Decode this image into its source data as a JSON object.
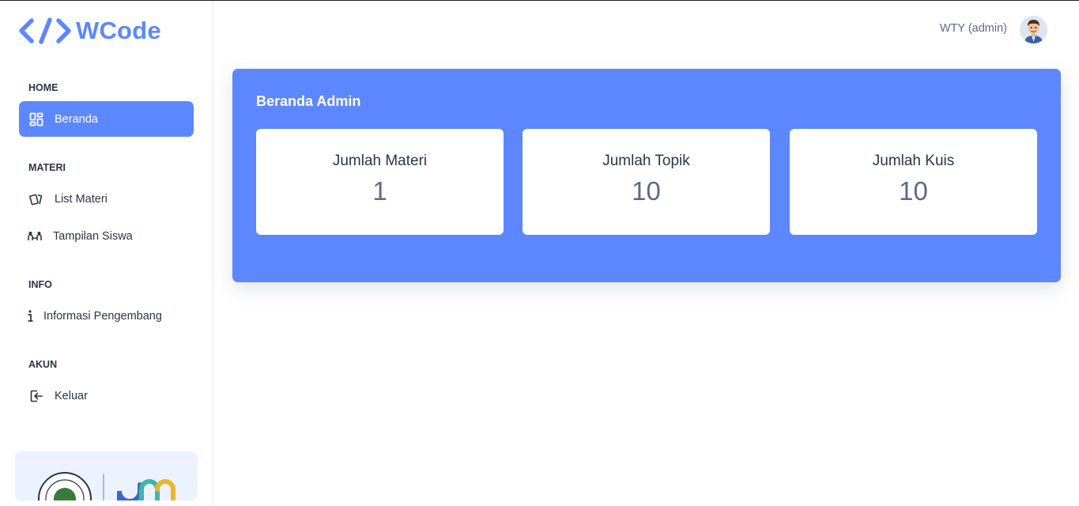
{
  "brand": {
    "name": "WCode",
    "accent_color": "#5d87ff"
  },
  "sidebar": {
    "sections": [
      {
        "title": "HOME"
      },
      {
        "title": "MATERI"
      },
      {
        "title": "INFO"
      },
      {
        "title": "AKUN"
      }
    ],
    "items": [
      {
        "label": "Beranda",
        "icon": "dashboard-icon",
        "active": true
      },
      {
        "label": "List Materi",
        "icon": "cards-icon",
        "active": false
      },
      {
        "label": "Tampilan Siswa",
        "icon": "users-icon",
        "active": false
      },
      {
        "label": "Informasi Pengembang",
        "icon": "info-icon",
        "active": false
      },
      {
        "label": "Keluar",
        "icon": "logout-icon",
        "active": false
      }
    ]
  },
  "header": {
    "user_name": "WTY (admin)",
    "avatar": "user-avatar"
  },
  "banner": {
    "title": "Beranda Admin",
    "color": "#5d87ff",
    "stats": [
      {
        "label": "Jumlah Materi",
        "value": "1"
      },
      {
        "label": "Jumlah Topik",
        "value": "10"
      },
      {
        "label": "Jumlah Kuis",
        "value": "10"
      }
    ]
  }
}
